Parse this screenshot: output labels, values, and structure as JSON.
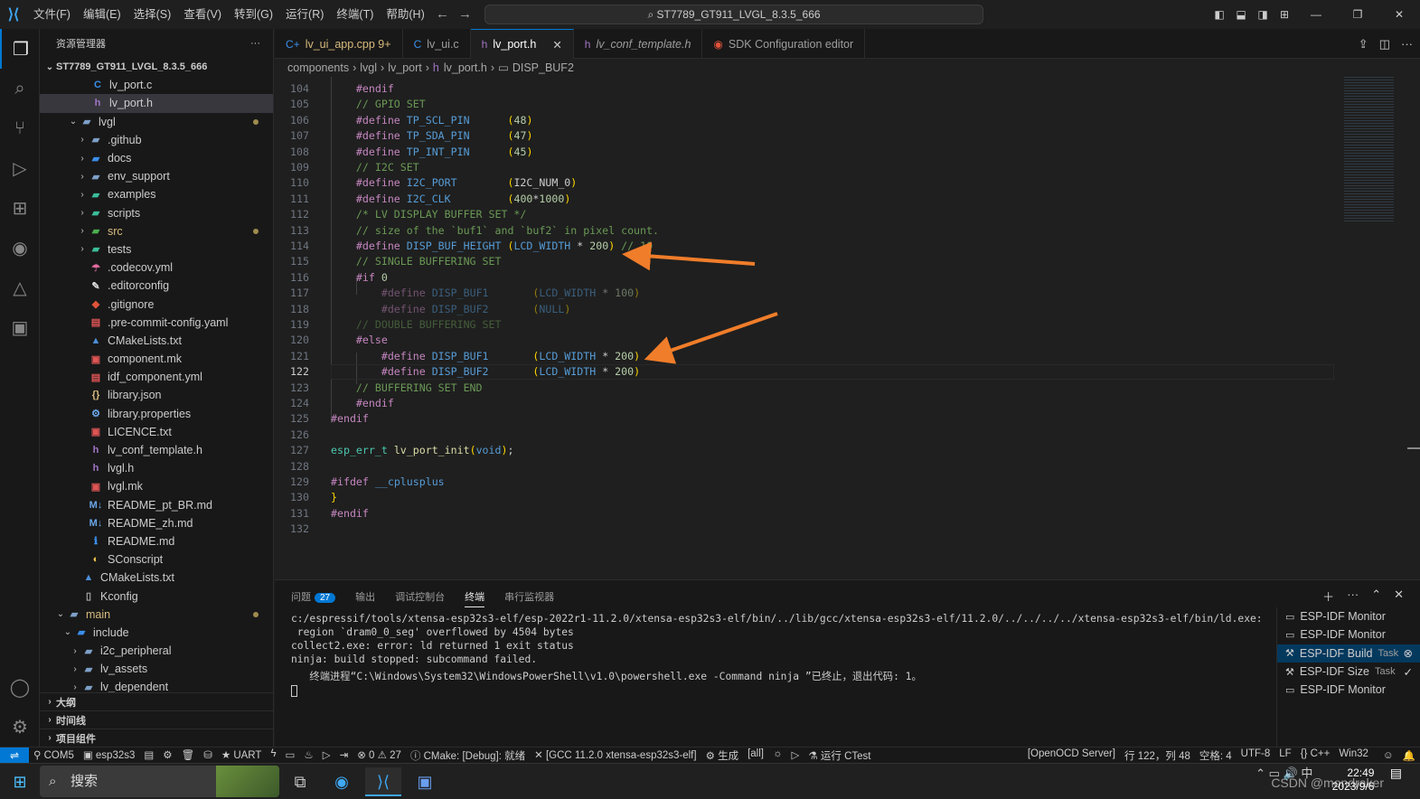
{
  "titlebar": {
    "menus": [
      "文件(F)",
      "编辑(E)",
      "选择(S)",
      "查看(V)",
      "转到(G)",
      "运行(R)",
      "终端(T)",
      "帮助(H)"
    ],
    "search": "ST7789_GT911_LVGL_8.3.5_666"
  },
  "explorer": {
    "title": "资源管理器",
    "root": "ST7789_GT911_LVGL_8.3.5_666",
    "outline": "大纲",
    "timeline": "时间线",
    "components": "项目组件"
  },
  "tree": [
    {
      "label": "lv_port.c",
      "icon": "C",
      "color": "#3b8eea",
      "indent": 56,
      "chev": ""
    },
    {
      "label": "lv_port.h",
      "icon": "h",
      "color": "#a074c4",
      "indent": 56,
      "chev": "",
      "sel": true
    },
    {
      "label": "lvgl",
      "icon": "▰",
      "color": "#7ea0c8",
      "indent": 30,
      "chev": "⌄",
      "dot": true
    },
    {
      "label": ".github",
      "icon": "▰",
      "color": "#7ea0c8",
      "indent": 40,
      "chev": "›"
    },
    {
      "label": "docs",
      "icon": "▰",
      "color": "#3b8eea",
      "indent": 40,
      "chev": "›"
    },
    {
      "label": "env_support",
      "icon": "▰",
      "color": "#7ea0c8",
      "indent": 40,
      "chev": "›"
    },
    {
      "label": "examples",
      "icon": "▰",
      "color": "#3bbd9a",
      "indent": 40,
      "chev": "›"
    },
    {
      "label": "scripts",
      "icon": "▰",
      "color": "#3bbd9a",
      "indent": 40,
      "chev": "›"
    },
    {
      "label": "src",
      "icon": "▰",
      "color": "#4caf50",
      "indent": 40,
      "chev": "›",
      "dot": true,
      "lc": "#d7ba7d"
    },
    {
      "label": "tests",
      "icon": "▰",
      "color": "#3bbd9a",
      "indent": 40,
      "chev": "›"
    },
    {
      "label": ".codecov.yml",
      "icon": "☂",
      "color": "#e06c9f",
      "indent": 54,
      "chev": ""
    },
    {
      "label": ".editorconfig",
      "icon": "✎",
      "color": "#dddddd",
      "indent": 54,
      "chev": ""
    },
    {
      "label": ".gitignore",
      "icon": "◆",
      "color": "#e0533a",
      "indent": 54,
      "chev": ""
    },
    {
      "label": ".pre-commit-config.yaml",
      "icon": "▤",
      "color": "#e05555",
      "indent": 54,
      "chev": ""
    },
    {
      "label": "CMakeLists.txt",
      "icon": "▲",
      "color": "#4c8ed8",
      "indent": 54,
      "chev": ""
    },
    {
      "label": "component.mk",
      "icon": "▣",
      "color": "#e05555",
      "indent": 54,
      "chev": ""
    },
    {
      "label": "idf_component.yml",
      "icon": "▤",
      "color": "#e05555",
      "indent": 54,
      "chev": ""
    },
    {
      "label": "library.json",
      "icon": "{}",
      "color": "#d7ba7d",
      "indent": 54,
      "chev": ""
    },
    {
      "label": "library.properties",
      "icon": "⚙",
      "color": "#6aa6e8",
      "indent": 54,
      "chev": ""
    },
    {
      "label": "LICENCE.txt",
      "icon": "▣",
      "color": "#e05555",
      "indent": 54,
      "chev": ""
    },
    {
      "label": "lv_conf_template.h",
      "icon": "h",
      "color": "#a074c4",
      "indent": 54,
      "chev": ""
    },
    {
      "label": "lvgl.h",
      "icon": "h",
      "color": "#a074c4",
      "indent": 54,
      "chev": ""
    },
    {
      "label": "lvgl.mk",
      "icon": "▣",
      "color": "#e05555",
      "indent": 54,
      "chev": ""
    },
    {
      "label": "README_pt_BR.md",
      "icon": "M↓",
      "color": "#6aa6e8",
      "indent": 54,
      "chev": ""
    },
    {
      "label": "README_zh.md",
      "icon": "M↓",
      "color": "#6aa6e8",
      "indent": 54,
      "chev": ""
    },
    {
      "label": "README.md",
      "icon": "ℹ",
      "color": "#3b8eea",
      "indent": 54,
      "chev": ""
    },
    {
      "label": "SConscript",
      "icon": "◐",
      "color": "#f2c94c",
      "indent": 54,
      "chev": ""
    },
    {
      "label": "CMakeLists.txt",
      "icon": "▲",
      "color": "#4c8ed8",
      "indent": 46,
      "chev": ""
    },
    {
      "label": "Kconfig",
      "icon": "▯",
      "color": "#aaaaaa",
      "indent": 46,
      "chev": ""
    },
    {
      "label": "main",
      "icon": "▰",
      "color": "#7ea0c8",
      "indent": 16,
      "chev": "⌄",
      "dot": true,
      "lc": "#d7ba7d"
    },
    {
      "label": "include",
      "icon": "▰",
      "color": "#3b8eea",
      "indent": 24,
      "chev": "⌄"
    },
    {
      "label": "i2c_peripheral",
      "icon": "▰",
      "color": "#7ea0c8",
      "indent": 32,
      "chev": "›"
    },
    {
      "label": "lv_assets",
      "icon": "▰",
      "color": "#7ea0c8",
      "indent": 32,
      "chev": "›"
    },
    {
      "label": "lv_dependent",
      "icon": "▰",
      "color": "#7ea0c8",
      "indent": 32,
      "chev": "›"
    }
  ],
  "tabs": [
    {
      "label": "lv_ui_app.cpp 9+",
      "icon": "C+",
      "color": "#3b8eea",
      "lc": "#d7ba7d"
    },
    {
      "label": "lv_ui.c",
      "icon": "C",
      "color": "#3b8eea"
    },
    {
      "label": "lv_port.h",
      "icon": "h",
      "color": "#a074c4",
      "active": true
    },
    {
      "label": "lv_conf_template.h",
      "icon": "h",
      "color": "#a074c4",
      "italic": true
    },
    {
      "label": "SDK Configuration editor",
      "icon": "◉",
      "color": "#e0533a"
    }
  ],
  "breadcrumb": [
    "components",
    "lvgl",
    "lv_port",
    "lv_port.h",
    "DISP_BUF2"
  ],
  "code": [
    {
      "n": 104,
      "t": "    <span class='kw'>#endif</span>"
    },
    {
      "n": 105,
      "t": "    <span class='cm'>// GPIO SET</span>"
    },
    {
      "n": 106,
      "t": "    <span class='kw'>#define</span> <span class='mac'>TP_SCL_PIN</span>      <span class='pu'>(</span><span class='num'>48</span><span class='pu'>)</span>"
    },
    {
      "n": 107,
      "t": "    <span class='kw'>#define</span> <span class='mac'>TP_SDA_PIN</span>      <span class='pu'>(</span><span class='num'>47</span><span class='pu'>)</span>"
    },
    {
      "n": 108,
      "t": "    <span class='kw'>#define</span> <span class='mac'>TP_INT_PIN</span>      <span class='pu'>(</span><span class='num'>45</span><span class='pu'>)</span>"
    },
    {
      "n": 109,
      "t": "    <span class='cm'>// I2C SET</span>"
    },
    {
      "n": 110,
      "t": "    <span class='kw'>#define</span> <span class='mac'>I2C_PORT</span>        <span class='pu'>(</span>I2C_NUM_0<span class='pu'>)</span>"
    },
    {
      "n": 111,
      "t": "    <span class='kw'>#define</span> <span class='mac'>I2C_CLK</span>         <span class='pu'>(</span><span class='num'>400</span>*<span class='num'>1000</span><span class='pu'>)</span>"
    },
    {
      "n": 112,
      "t": "    <span class='cm'>/* LV DISPLAY BUFFER SET */</span>"
    },
    {
      "n": 113,
      "t": "    <span class='cm'>// size of the `buf1` and `buf2` in pixel count.</span>"
    },
    {
      "n": 114,
      "t": "    <span class='kw'>#define</span> <span class='mac'>DISP_BUF_HEIGHT</span> <span class='pu'>(</span><span class='mac'>LCD_WIDTH</span> * <span class='num'>200</span><span class='pu'>)</span> <span class='cm'>// 10</span>"
    },
    {
      "n": 115,
      "t": "    <span class='cm'>// SINGLE BUFFERING SET</span>"
    },
    {
      "n": 116,
      "t": "    <span class='kw'>#if</span> <span class='num'>0</span>"
    },
    {
      "n": 117,
      "t": "        <span class='dim'><span class='kw'>#define</span> <span class='mac'>DISP_BUF1</span>       <span class='pu'>(</span><span class='mac'>LCD_WIDTH</span> * <span class='num'>100</span><span class='pu'>)</span></span>"
    },
    {
      "n": 118,
      "t": "        <span class='dim'><span class='kw'>#define</span> <span class='mac'>DISP_BUF2</span>       <span class='pu'>(</span><span class='mac'>NULL</span><span class='pu'>)</span></span>"
    },
    {
      "n": 119,
      "t": "    <span class='dim cm'>// DOUBLE BUFFERING SET</span>"
    },
    {
      "n": 120,
      "t": "    <span class='kw'>#else</span>"
    },
    {
      "n": 121,
      "t": "        <span class='kw'>#define</span> <span class='mac'>DISP_BUF1</span>       <span class='pu'>(</span><span class='mac'>LCD_WIDTH</span> * <span class='num'>200</span><span class='pu'>)</span>"
    },
    {
      "n": 122,
      "t": "        <span class='kw'>#define</span> <span class='mac'>DISP_BUF2</span>       <span class='pu'>(</span><span class='mac'>LCD_WIDTH</span> * <span class='num'>200</span><span class='pu'>)</span>",
      "cur": true
    },
    {
      "n": 123,
      "t": "    <span class='cm'>// BUFFERING SET END</span>"
    },
    {
      "n": 124,
      "t": "    <span class='kw'>#endif</span>"
    },
    {
      "n": 125,
      "t": "<span class='kw'>#endif</span>"
    },
    {
      "n": 126,
      "t": ""
    },
    {
      "n": 127,
      "t": "<span class='ty'>esp_err_t</span> <span class='fn'>lv_port_init</span><span class='pu'>(</span><span class='mac'>void</span><span class='pu'>)</span>;"
    },
    {
      "n": 128,
      "t": ""
    },
    {
      "n": 129,
      "t": "<span class='kw'>#ifdef</span> <span class='mac'>__cplusplus</span>"
    },
    {
      "n": 130,
      "t": "<span class='pu'>}</span>"
    },
    {
      "n": 131,
      "t": "<span class='kw'>#endif</span>"
    },
    {
      "n": 132,
      "t": ""
    }
  ],
  "panel": {
    "tabs": [
      "问题",
      "输出",
      "调试控制台",
      "终端",
      "串行监视器"
    ],
    "problems_count": "27",
    "terminal_lines": [
      "c:/espressif/tools/xtensa-esp32s3-elf/esp-2022r1-11.2.0/xtensa-esp32s3-elf/bin/../lib/gcc/xtensa-esp32s3-elf/11.2.0/../../../../xtensa-esp32s3-elf/bin/ld.exe:",
      " region `dram0_0_seg' overflowed by 4504 bytes",
      "collect2.exe: error: ld returned 1 exit status",
      "ninja: build stopped: subcommand failed.",
      "",
      "   终端进程“C:\\Windows\\System32\\WindowsPowerShell\\v1.0\\powershell.exe -Command ninja ”已终止，退出代码: 1。"
    ],
    "terminals": [
      {
        "label": "ESP-IDF Monitor",
        "tag": ""
      },
      {
        "label": "ESP-IDF Monitor",
        "tag": ""
      },
      {
        "label": "ESP-IDF Build",
        "tag": "Task",
        "sel": true
      },
      {
        "label": "ESP-IDF Size",
        "tag": "Task"
      },
      {
        "label": "ESP-IDF Monitor",
        "tag": ""
      }
    ]
  },
  "status": {
    "items": [
      "⚲ COM5",
      "▣ esp32s3",
      "▤",
      "⚙",
      "🗑",
      "⛁",
      "★ UART",
      "ϟ",
      "▭",
      "♨",
      "▷",
      "⇥",
      "⊗ 0 ⚠ 27",
      "ⓘ CMake: [Debug]: 就绪",
      "✕ [GCC 11.2.0 xtensa-esp32s3-elf]",
      "⚙ 生成",
      "[all]",
      "☼",
      "▷",
      "⚗ 运行 CTest"
    ],
    "right": [
      "[OpenOCD Server]",
      "行 122，列 48",
      "空格: 4",
      "UTF-8",
      "LF",
      "{} C++",
      "Win32"
    ]
  },
  "taskbar": {
    "search": "搜索",
    "time": "22:49",
    "date": "2023/9/6",
    "watermark": "CSDN @mondraker"
  }
}
